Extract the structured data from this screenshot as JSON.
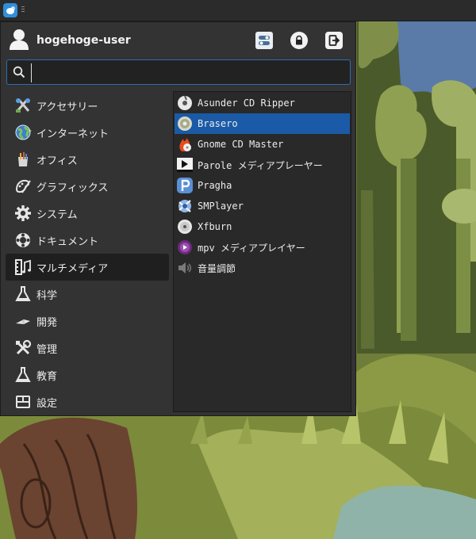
{
  "panel": {
    "menu_button_icon": "xfce-mouse-icon"
  },
  "menu": {
    "username": "hogehoge-user",
    "actions": {
      "settings_icon": "settings-manager-icon",
      "lock_icon": "lock-screen-icon",
      "logout_icon": "logout-icon"
    },
    "search": {
      "value": "",
      "placeholder": ""
    },
    "categories": [
      {
        "label": "アクセサリー",
        "icon": "accessories-icon"
      },
      {
        "label": "インターネット",
        "icon": "globe-icon"
      },
      {
        "label": "オフィス",
        "icon": "office-icon"
      },
      {
        "label": "グラフィックス",
        "icon": "graphics-icon"
      },
      {
        "label": "システム",
        "icon": "gear-icon"
      },
      {
        "label": "ドキュメント",
        "icon": "help-lifebuoy-icon"
      },
      {
        "label": "マルチメディア",
        "icon": "film-music-icon",
        "active": true
      },
      {
        "label": "科学",
        "icon": "flask-icon"
      },
      {
        "label": "開発",
        "icon": "trowel-icon"
      },
      {
        "label": "管理",
        "icon": "tools-icon"
      },
      {
        "label": "教育",
        "icon": "flask-icon"
      },
      {
        "label": "設定",
        "icon": "settings-panel-icon"
      }
    ],
    "apps": [
      {
        "label": "Asunder CD Ripper",
        "icon": "cd-icon"
      },
      {
        "label": "Brasero",
        "icon": "disc-burner-icon",
        "selected": true
      },
      {
        "label": "Gnome CD Master",
        "icon": "flame-disc-icon"
      },
      {
        "label": "Parole メディアプレーヤー",
        "icon": "play-icon"
      },
      {
        "label": "Pragha",
        "icon": "pragha-icon"
      },
      {
        "label": "SMPlayer",
        "icon": "smplayer-icon"
      },
      {
        "label": "Xfburn",
        "icon": "disc-icon"
      },
      {
        "label": "mpv メディアプレイヤー",
        "icon": "mpv-icon"
      },
      {
        "label": "音量調節",
        "icon": "speaker-icon"
      }
    ]
  },
  "colors": {
    "menu_bg": "#333333",
    "selection": "#1b5aa6",
    "search_border": "#2f6db0",
    "panel_bg": "#2b2b2b"
  }
}
